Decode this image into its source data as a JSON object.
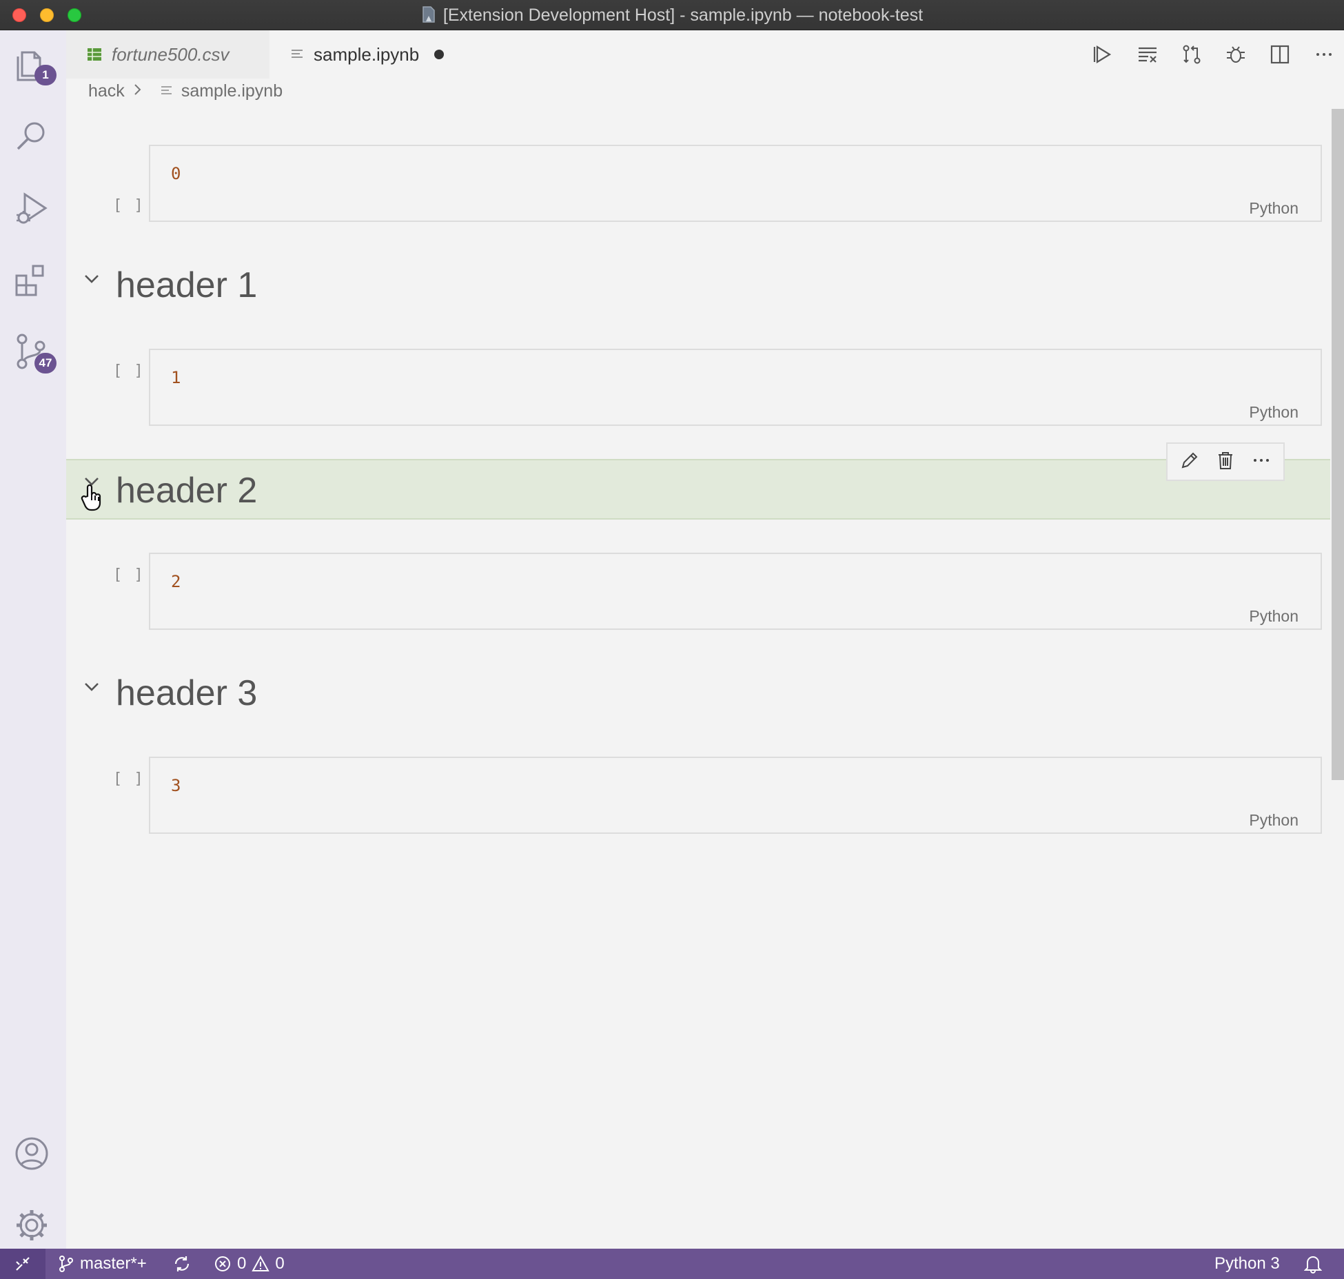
{
  "window": {
    "title": "[Extension Development Host] - sample.ipynb — notebook-test"
  },
  "activity_bar": {
    "explorer_badge": "1",
    "scm_badge": "47"
  },
  "tabs": [
    {
      "label": "fortune500.csv",
      "active": false
    },
    {
      "label": "sample.ipynb",
      "active": true,
      "dirty": true
    }
  ],
  "breadcrumb": {
    "folder": "hack",
    "file": "sample.ipynb"
  },
  "cells": [
    {
      "exec": "[ ]",
      "code": "0",
      "lang": "Python"
    },
    {
      "heading": "header 1"
    },
    {
      "exec": "[ ]",
      "code": "1",
      "lang": "Python"
    },
    {
      "heading": "header 2",
      "selected": true
    },
    {
      "exec": "[ ]",
      "code": "2",
      "lang": "Python"
    },
    {
      "heading": "header 3"
    },
    {
      "exec": "[ ]",
      "code": "3",
      "lang": "Python"
    }
  ],
  "status_bar": {
    "branch": "master*+",
    "errors": "0",
    "warnings": "0",
    "kernel": "Python 3"
  },
  "colors": {
    "accent": "#6b5391",
    "selected_cell_bg": "#e2eadb",
    "code_number": "#a1511f"
  }
}
